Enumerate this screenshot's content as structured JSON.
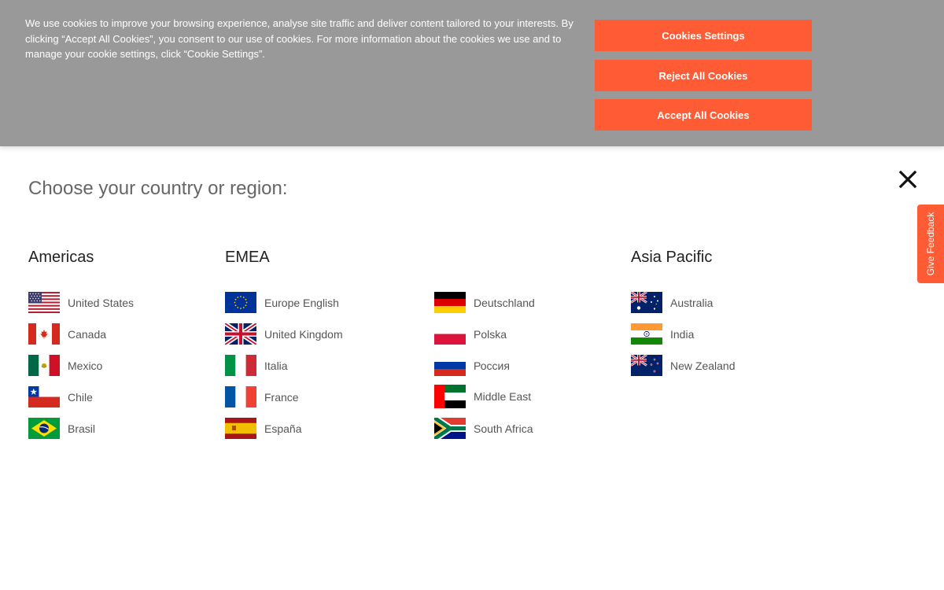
{
  "cookie_banner": {
    "text": "We use cookies to improve your browsing experience, analyse site traffic and deliver content tailored to your interests. By clicking “Accept All Cookies”, you consent to our use of cookies. For more information about the cookies we use and to manage your cookie settings, click “Cookie Settings”.",
    "settings_label": "Cookies Settings",
    "reject_label": "Reject All Cookies",
    "accept_label": "Accept All Cookies",
    "button_color": "#ff5c35"
  },
  "region_selector": {
    "title": "Choose your country or region:",
    "close_icon": "close-icon",
    "regions": {
      "americas": {
        "heading": "Americas",
        "countries": [
          {
            "name": "United States",
            "flag": "flag-us-icon"
          },
          {
            "name": "Canada",
            "flag": "flag-canada-icon"
          },
          {
            "name": "Mexico",
            "flag": "flag-mexico-icon"
          },
          {
            "name": "Chile",
            "flag": "flag-chile-icon"
          },
          {
            "name": "Brasil",
            "flag": "flag-brazil-icon"
          }
        ]
      },
      "emea": {
        "heading": "EMEA",
        "countries": [
          {
            "name": "Europe English",
            "flag": "flag-eu-icon"
          },
          {
            "name": "United Kingdom",
            "flag": "flag-uk-icon"
          },
          {
            "name": "Italia",
            "flag": "flag-italy-icon"
          },
          {
            "name": "France",
            "flag": "flag-france-icon"
          },
          {
            "name": "España",
            "flag": "flag-spain-icon"
          },
          {
            "name": "Deutschland",
            "flag": "flag-germany-icon"
          },
          {
            "name": "Polska",
            "flag": "flag-poland-icon"
          },
          {
            "name": "Россия",
            "flag": "flag-russia-icon"
          },
          {
            "name": "Middle East",
            "flag": "flag-uae-icon"
          },
          {
            "name": "South Africa",
            "flag": "flag-south-africa-icon"
          }
        ]
      },
      "asia_pacific": {
        "heading": "Asia Pacific",
        "countries": [
          {
            "name": "Australia",
            "flag": "flag-australia-icon"
          },
          {
            "name": "India",
            "flag": "flag-india-icon"
          },
          {
            "name": "New Zealand",
            "flag": "flag-new-zealand-icon"
          }
        ]
      }
    }
  },
  "feedback_tab": {
    "label": "Give Feedback",
    "color": "#ff5c35"
  }
}
